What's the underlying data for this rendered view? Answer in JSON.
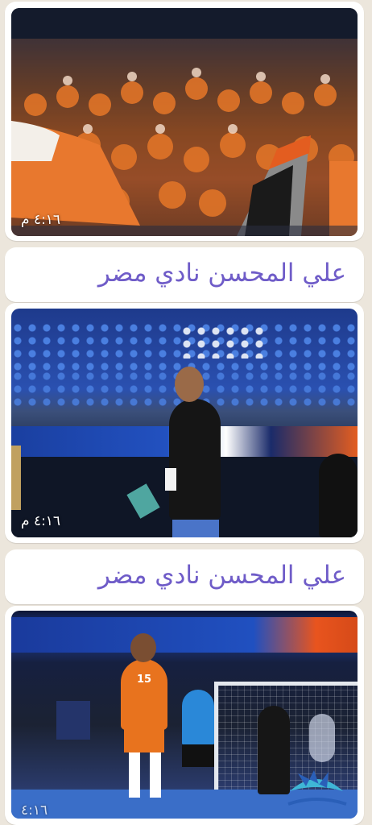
{
  "messages": [
    {
      "type": "image",
      "description_icon": "crowd-photo",
      "time": "٤:١٦ م"
    },
    {
      "type": "caption",
      "text": "علي المحسن نادي مضر"
    },
    {
      "type": "image",
      "description_icon": "coach-photo",
      "time": "٤:١٦ م"
    },
    {
      "type": "caption",
      "text": "علي المحسن نادي مضر"
    },
    {
      "type": "image",
      "description_icon": "player-photo",
      "time": "٤:١٦"
    }
  ],
  "colors": {
    "chat_bg": "#ece6dc",
    "bubble_bg": "#ffffff",
    "caption_text": "#6f5cc8"
  },
  "photo3": {
    "jersey_number": "15"
  }
}
